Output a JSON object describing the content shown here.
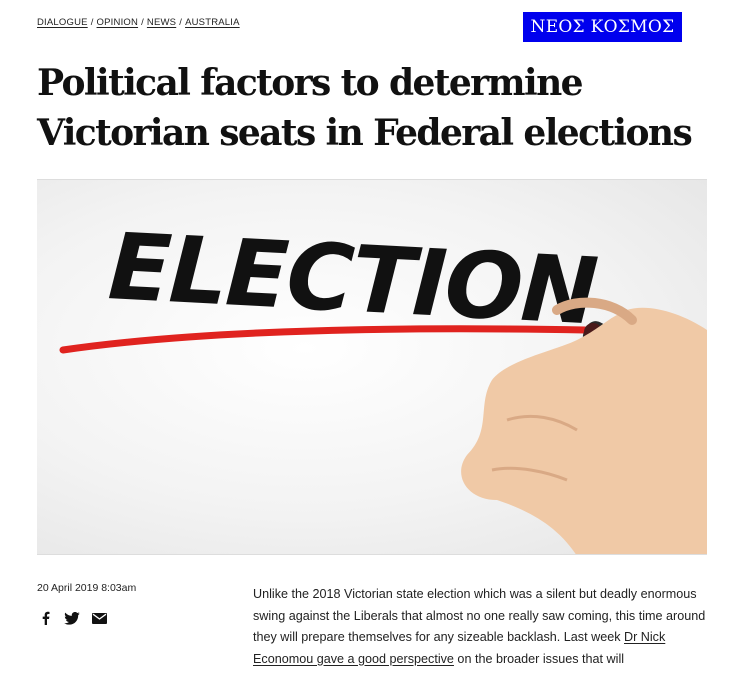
{
  "breadcrumb": {
    "items": [
      "DIALOGUE",
      "OPINION",
      "NEWS",
      "AUSTRALIA"
    ],
    "separator": "/"
  },
  "logo": {
    "text": "ΝΕΟΣ ΚΟΣΜΟΣ",
    "bg_color": "#0000ee"
  },
  "article": {
    "title": "Political factors to determine Victorian seats in Federal elections",
    "hero_image_text": "ELECTION",
    "date": "20 April 2019 8:03am",
    "share_icons": [
      "facebook-icon",
      "twitter-icon",
      "email-icon"
    ],
    "body_part1": "Unlike the 2018 Victorian state election which was a silent but deadly enormous swing against the Liberals that almost no one really saw coming, this time around they will prepare themselves for any sizeable backlash. Last week ",
    "body_link": "Dr Nick Economou gave a good perspective",
    "body_part2": " on the broader issues that will"
  },
  "colors": {
    "underline_red": "#e0231f",
    "ink": "#111111"
  }
}
